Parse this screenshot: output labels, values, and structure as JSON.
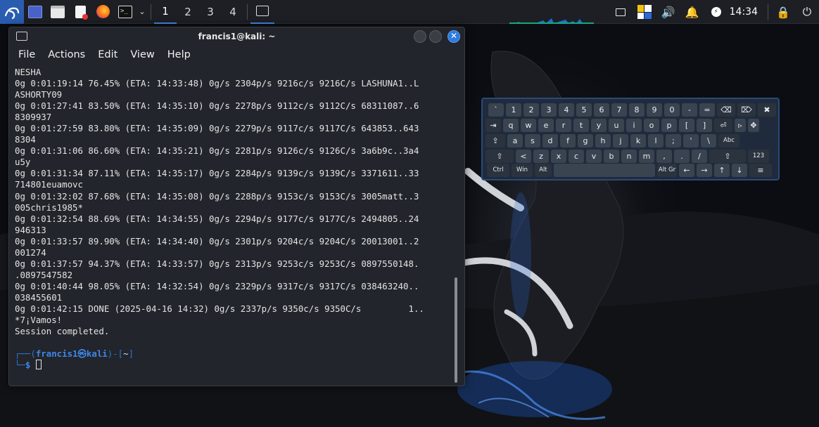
{
  "panel": {
    "workspaces": [
      "1",
      "2",
      "3",
      "4"
    ],
    "active_workspace": "1",
    "clock": "14:34",
    "icons": [
      "kali-menu-icon",
      "desktop-icon",
      "file-manager-icon",
      "text-editor-icon",
      "firefox-icon",
      "terminal-icon",
      "chevron-down-icon",
      "workspace-terminal-icon",
      "display-icon",
      "cpu-meter-icon",
      "volume-icon",
      "notifications-icon",
      "power-icon",
      "lock-icon",
      "logout-icon"
    ]
  },
  "terminal": {
    "title": "francis1@kali: ~",
    "menu": [
      "File",
      "Actions",
      "Edit",
      "View",
      "Help"
    ],
    "lines": [
      "NESHA",
      "0g 0:01:19:14 76.45% (ETA: 14:33:48) 0g/s 2304p/s 9216c/s 9216C/s LASHUNA1..L",
      "ASHORTY09",
      "0g 0:01:27:41 83.50% (ETA: 14:35:10) 0g/s 2278p/s 9112c/s 9112C/s 68311087..6",
      "8309937",
      "0g 0:01:27:59 83.80% (ETA: 14:35:09) 0g/s 2279p/s 9117c/s 9117C/s 643853..643",
      "8304",
      "0g 0:01:31:06 86.60% (ETA: 14:35:21) 0g/s 2281p/s 9126c/s 9126C/s 3a6b9c..3a4",
      "u5y",
      "0g 0:01:31:34 87.11% (ETA: 14:35:17) 0g/s 2284p/s 9139c/s 9139C/s 3371611..33",
      "714801euamovc",
      "0g 0:01:32:02 87.68% (ETA: 14:35:08) 0g/s 2288p/s 9153c/s 9153C/s 3005matt..3",
      "005chris1985*",
      "0g 0:01:32:54 88.69% (ETA: 14:34:55) 0g/s 2294p/s 9177c/s 9177C/s 2494805..24",
      "946313",
      "0g 0:01:33:57 89.90% (ETA: 14:34:40) 0g/s 2301p/s 9204c/s 9204C/s 20013001..2",
      "001274",
      "0g 0:01:37:57 94.37% (ETA: 14:33:57) 0g/s 2313p/s 9253c/s 9253C/s 0897550148.",
      ".0897547582",
      "0g 0:01:40:44 98.05% (ETA: 14:32:54) 0g/s 2329p/s 9317c/s 9317C/s 038463240..",
      "038455601",
      "0g 0:01:42:15 DONE (2025-04-16 14:32) 0g/s 2337p/s 9350c/s 9350C/s         1..",
      "*7¡Vamos!",
      "Session completed."
    ],
    "prompt_user": "francis1㉿kali",
    "prompt_dir": "~",
    "prompt_symbol": "$"
  },
  "keyboard": {
    "row1": [
      "`",
      "1",
      "2",
      "3",
      "4",
      "5",
      "6",
      "7",
      "8",
      "9",
      "0",
      "-",
      "=",
      "⌫",
      "⌦",
      "✖"
    ],
    "row2": [
      "⇥",
      "q",
      "w",
      "e",
      "r",
      "t",
      "y",
      "u",
      "i",
      "o",
      "p",
      "[",
      "]",
      "⏎",
      "▹",
      "✥"
    ],
    "row3": [
      "⇪",
      "a",
      "s",
      "d",
      "f",
      "g",
      "h",
      "j",
      "k",
      "l",
      ";",
      "'",
      "\\",
      "Abc"
    ],
    "row4": [
      "⇧",
      "<",
      "z",
      "x",
      "c",
      "v",
      "b",
      "n",
      "m",
      ",",
      ".",
      "/",
      "⇧",
      "123"
    ],
    "row5": [
      "Ctrl",
      "Win",
      "Alt",
      "",
      "Alt Gr",
      "←",
      "→",
      "↑",
      "↓",
      "≡"
    ]
  }
}
